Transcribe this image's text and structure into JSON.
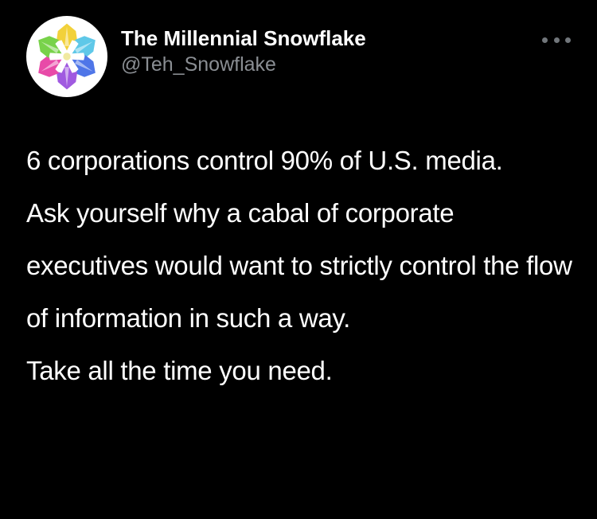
{
  "author": {
    "display_name": "The Millennial Snowflake",
    "handle": "@Teh_Snowflake",
    "avatar_icon": "rainbow-snowflake-icon"
  },
  "more_icon": "more-horizontal-icon",
  "tweet": {
    "paragraphs": [
      "6 corporations control 90% of U.S. media.",
      "Ask yourself why a cabal of corporate executives would want to strictly control the flow of information in such a way.",
      "Take all the time you need."
    ]
  },
  "colors": {
    "background": "#000000",
    "text": "#ffffff",
    "secondary_text": "#8a8e93"
  }
}
